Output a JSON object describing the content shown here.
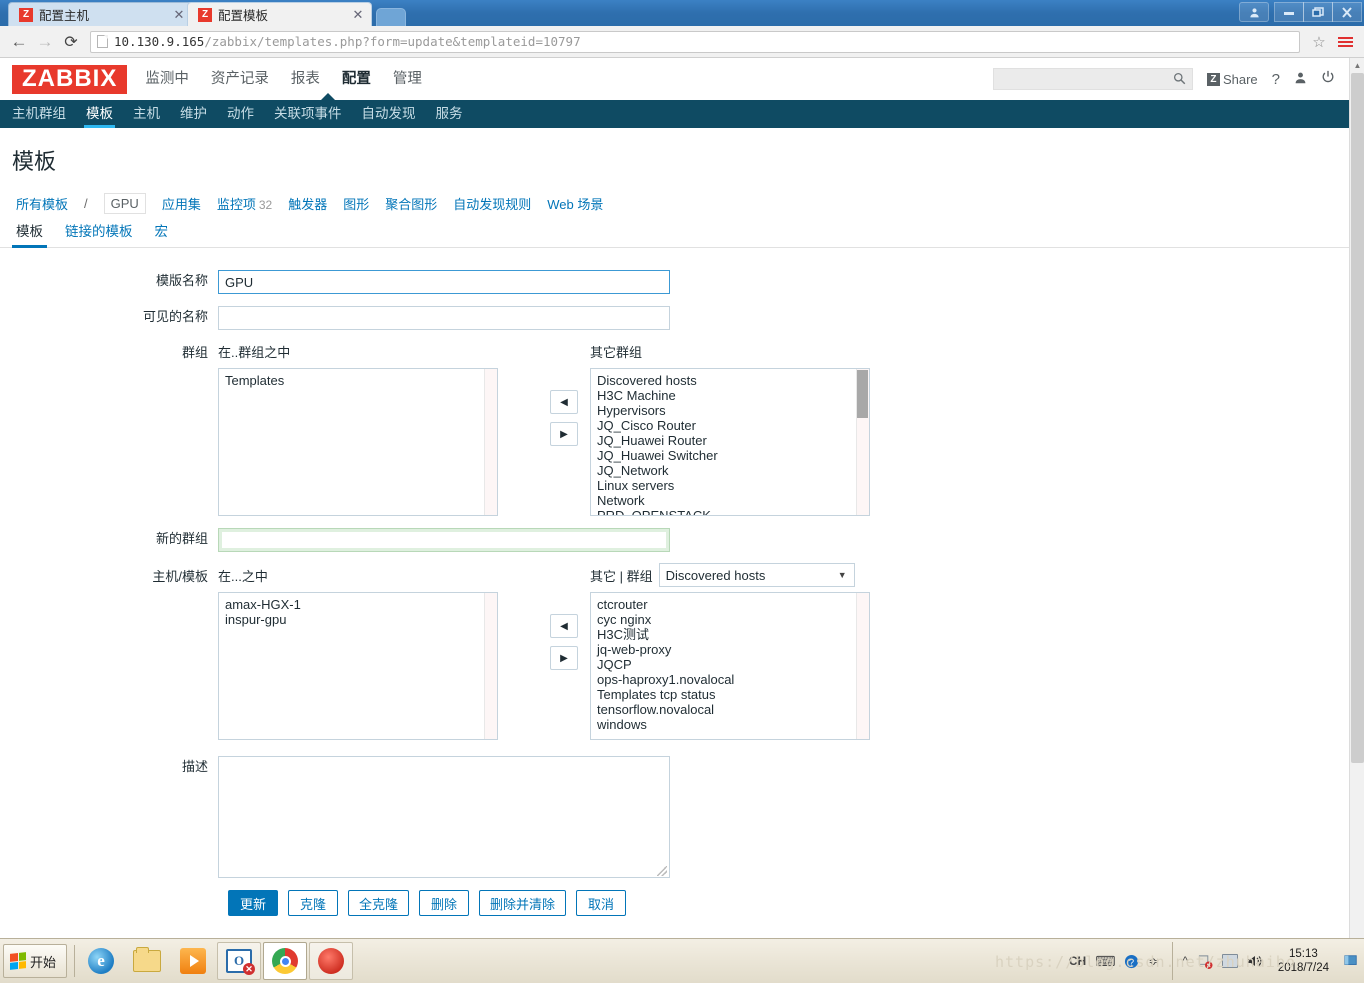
{
  "browser": {
    "tabs": [
      {
        "title": "配置主机",
        "favicon": "Z",
        "active": false,
        "close": "✕"
      },
      {
        "title": "配置模板",
        "favicon": "Z",
        "active": true,
        "close": "✕"
      }
    ],
    "new_tab_label": "",
    "window_controls": {
      "user": "👤",
      "minimize": "—",
      "restore": "❐",
      "close": "✕"
    },
    "back": "←",
    "forward": "→",
    "reload": "⟳",
    "url_host": "10.130.9.165",
    "url_path": "/zabbix/templates.php?form=update&templateid=10797",
    "star": "☆",
    "menu": "menu"
  },
  "zabbix": {
    "logo": "ZABBIX",
    "main_nav": [
      {
        "label": "监测中",
        "selected": false
      },
      {
        "label": "资产记录",
        "selected": false
      },
      {
        "label": "报表",
        "selected": false
      },
      {
        "label": "配置",
        "selected": true
      },
      {
        "label": "管理",
        "selected": false
      }
    ],
    "search_placeholder": "",
    "search_value": "",
    "search_icon": "⌕",
    "share_label": "Share",
    "share_mark": "Z",
    "help_icon": "?",
    "user_icon": "👤",
    "power_icon": "⏻",
    "sub_nav": [
      {
        "label": "主机群组",
        "selected": false
      },
      {
        "label": "模板",
        "selected": true
      },
      {
        "label": "主机",
        "selected": false
      },
      {
        "label": "维护",
        "selected": false
      },
      {
        "label": "动作",
        "selected": false
      },
      {
        "label": "关联项事件",
        "selected": false
      },
      {
        "label": "自动发现",
        "selected": false
      },
      {
        "label": "服务",
        "selected": false
      }
    ],
    "page_title": "模板",
    "breadcrumb": {
      "all_templates": "所有模板",
      "separator": "/",
      "current": "GPU",
      "links": [
        {
          "label": "应用集",
          "count": ""
        },
        {
          "label": "监控项",
          "count": "32"
        },
        {
          "label": "触发器",
          "count": ""
        },
        {
          "label": "图形",
          "count": ""
        },
        {
          "label": "聚合图形",
          "count": ""
        },
        {
          "label": "自动发现规则",
          "count": ""
        },
        {
          "label": "Web 场景",
          "count": ""
        }
      ]
    },
    "form_tabs": [
      {
        "label": "模板",
        "selected": true
      },
      {
        "label": "链接的模板",
        "selected": false
      },
      {
        "label": "宏",
        "selected": false
      }
    ]
  },
  "form": {
    "template_name": {
      "label": "模版名称",
      "value": "GPU"
    },
    "visible_name": {
      "label": "可见的名称",
      "value": ""
    },
    "groups": {
      "label": "群组",
      "in_label": "在..群组之中",
      "other_label": "其它群组",
      "in_items": [
        "Templates"
      ],
      "other_items": [
        "Discovered hosts",
        "H3C Machine",
        "Hypervisors",
        "JQ_Cisco Router",
        "JQ_Huawei Router",
        "JQ_Huawei Switcher",
        "JQ_Network",
        "Linux servers",
        "Network",
        "PRD_OPENSTACK"
      ],
      "move_left_icon": "◀",
      "move_right_icon": "▶"
    },
    "new_group": {
      "label": "新的群组",
      "value": ""
    },
    "hosts_templates": {
      "label": "主机/模板",
      "in_label": "在...之中",
      "other_label": "其它 | 群组",
      "group_select_value": "Discovered hosts",
      "caret": "▼",
      "in_items": [
        "amax-HGX-1",
        "inspur-gpu"
      ],
      "other_items": [
        "ctcrouter",
        "cyc nginx",
        "H3C测试",
        "jq-web-proxy",
        "JQCP",
        "ops-haproxy1.novalocal",
        "Templates tcp status",
        "tensorflow.novalocal",
        "windows"
      ],
      "move_left_icon": "◀",
      "move_right_icon": "▶"
    },
    "description": {
      "label": "描述",
      "value": ""
    },
    "buttons": [
      {
        "label": "更新",
        "primary": true
      },
      {
        "label": "克隆",
        "primary": false
      },
      {
        "label": "全克隆",
        "primary": false
      },
      {
        "label": "删除",
        "primary": false
      },
      {
        "label": "删除并清除",
        "primary": false
      },
      {
        "label": "取消",
        "primary": false
      }
    ]
  },
  "taskbar": {
    "start_label": "开始",
    "items": [
      {
        "name": "internet-explorer",
        "active": false
      },
      {
        "name": "file-explorer",
        "active": false
      },
      {
        "name": "media-player",
        "active": false
      },
      {
        "name": "outlook",
        "active": false
      },
      {
        "name": "chrome",
        "active": true
      },
      {
        "name": "red-app",
        "active": false
      }
    ],
    "tray": {
      "input_method": "CH",
      "keyboard_icon": "⌨",
      "help_icon": "?",
      "show_hidden_icon": "≎",
      "chevron_icon": "^",
      "action_center_icon": "⚑",
      "network_icon": "net",
      "volume_icon": "🔊",
      "time": "15:13",
      "date": "2018/7/24"
    },
    "watermark": "https://blog.csdn.net/zhuhaibo"
  }
}
